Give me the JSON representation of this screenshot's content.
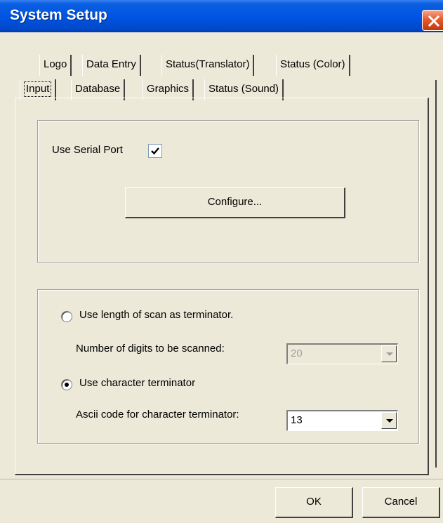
{
  "window": {
    "title": "System Setup"
  },
  "tabs": {
    "row1": [
      "Logo",
      "Data Entry",
      "Status(Translator)",
      "Status (Color)"
    ],
    "row2": [
      "Input",
      "Database",
      "Graphics",
      "Status (Sound)"
    ],
    "active": "Input"
  },
  "serial": {
    "use_serial_label": "Use Serial Port",
    "use_serial_checked": true,
    "configure_label": "Configure..."
  },
  "terminator": {
    "length_option_label": "Use length of scan as terminator.",
    "length_option_selected": false,
    "digits_label": "Number of digits to be scanned:",
    "digits_value": "20",
    "char_option_label": "Use character terminator",
    "char_option_selected": true,
    "ascii_label": "Ascii code for character terminator:",
    "ascii_value": "13"
  },
  "footer": {
    "ok_label": "OK",
    "cancel_label": "Cancel"
  },
  "colors": {
    "titlebar": "#0054E3",
    "face": "#ECE9D8",
    "close": "#E45A2B"
  },
  "icons": {
    "close": "close-icon",
    "check": "check-icon",
    "dropdown": "chevron-down-icon"
  }
}
